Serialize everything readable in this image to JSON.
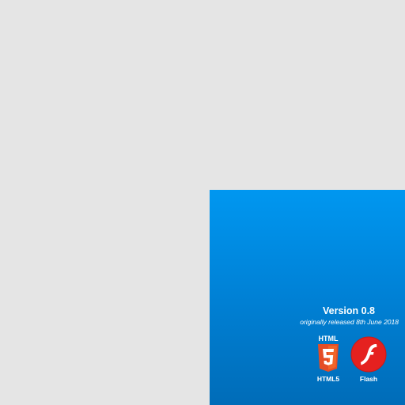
{
  "colors": {
    "background": "#e5e5e5",
    "panel_top": "#0097f0",
    "panel_bottom": "#006cb8",
    "html5_orange": "#e44d26",
    "html5_light": "#f16529",
    "flash_red": "#e5211f"
  },
  "info": {
    "version": "Version 0.8",
    "release": "originally released 8th June 2018"
  },
  "platforms": [
    {
      "label": "HTML5",
      "logo_text": "HTML",
      "icon": "html5-shield-icon"
    },
    {
      "label": "Flash",
      "icon": "flash-player-icon"
    }
  ]
}
